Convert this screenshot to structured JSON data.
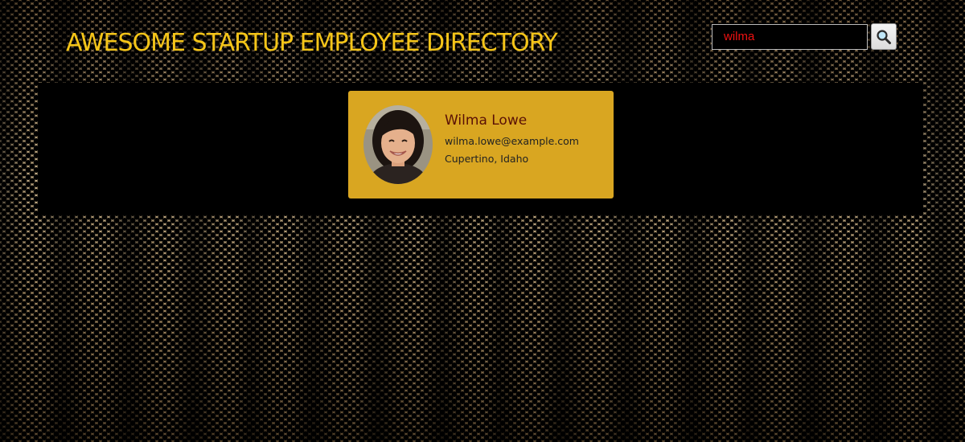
{
  "header": {
    "title": "AWESOME STARTUP EMPLOYEE DIRECTORY"
  },
  "search": {
    "value": "wilma",
    "button_icon": "magnifying-glass-icon"
  },
  "colors": {
    "title": "#f5c518",
    "card_background": "#d9a621",
    "name": "#5a1006",
    "search_text": "#e11111",
    "gallery_background": "#000000"
  },
  "employees": [
    {
      "name": "Wilma Lowe",
      "email": "wilma.lowe@example.com",
      "location": "Cupertino, Idaho",
      "avatar": "employee-photo"
    }
  ]
}
